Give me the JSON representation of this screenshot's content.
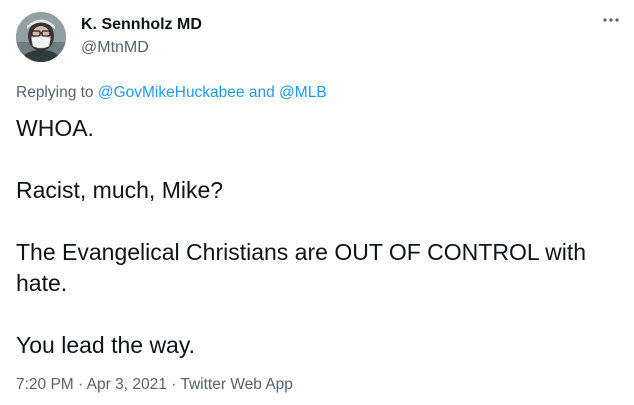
{
  "author": {
    "display_name": "K. Sennholz MD",
    "handle": "@MtnMD",
    "avatar_icon": "profile-photo-masked-person"
  },
  "more_icon": "more-horizontal-icon",
  "replying": {
    "prefix": "Replying to",
    "mention_1": "@GovMikeHuckabee",
    "conjunction": "and",
    "mention_2": "@MLB"
  },
  "tweet_paragraphs": [
    "WHOA.",
    "Racist, much, Mike?",
    "The Evangelical Christians are OUT OF CONTROL with hate.",
    "You lead the way."
  ],
  "meta": {
    "time": "7:20 PM",
    "separator_1": "·",
    "date": "Apr 3, 2021",
    "separator_2": "·",
    "source": "Twitter Web App"
  },
  "colors": {
    "text_primary": "#0f1419",
    "text_secondary": "#536471",
    "link": "#1d9bf0"
  }
}
